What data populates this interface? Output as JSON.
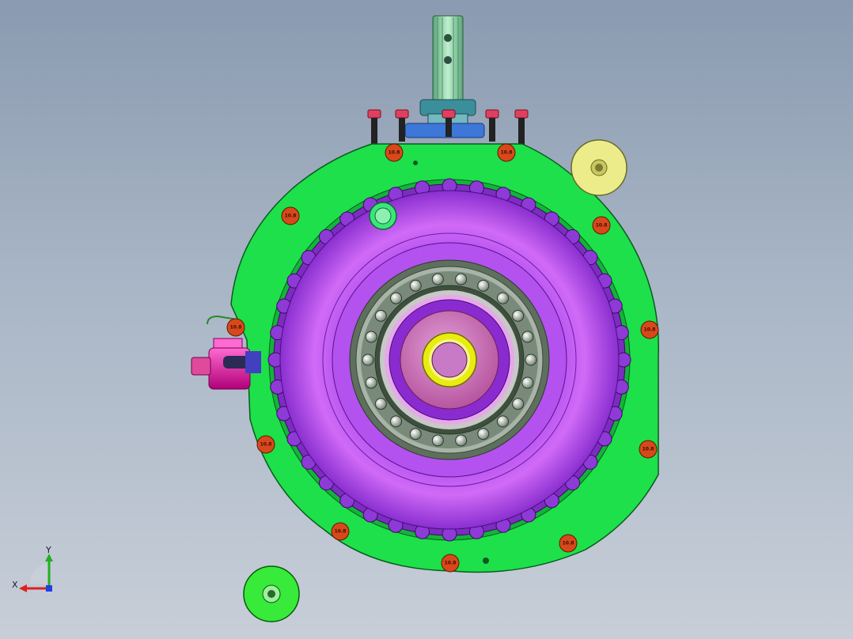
{
  "viewport": {
    "background_top": "#8a9ab0",
    "background_bottom": "#c7ced8"
  },
  "triad": {
    "x_label": "X",
    "y_label": "Y",
    "x_color": "#e02020",
    "y_color": "#20b020",
    "z_color": "#2040e0"
  },
  "parts": {
    "housing_color": "#1ee04a",
    "rotor_color": "#b44ef0",
    "bearing_race_color": "#5e6f5e",
    "inner_hub_color": "#d07ac8",
    "center_ring_color": "#e8ec10",
    "shaft_color": "#8fd6a6",
    "actuator_color": "#e81aa8",
    "bolt_color": "#d9481a",
    "washer_top_color": "#ecec8a",
    "washer_bottom_color": "#38ea3a"
  },
  "bolt_labels": {
    "b1": "10.8",
    "b2": "10.8",
    "b3": "10.8",
    "b4": "10.8",
    "b5": "10.8",
    "b6": "10.8",
    "b7": "10.8",
    "b8": "10.8",
    "b9": "10.8",
    "b10": "10.8",
    "b11": "10.8",
    "b12": "10.8"
  }
}
